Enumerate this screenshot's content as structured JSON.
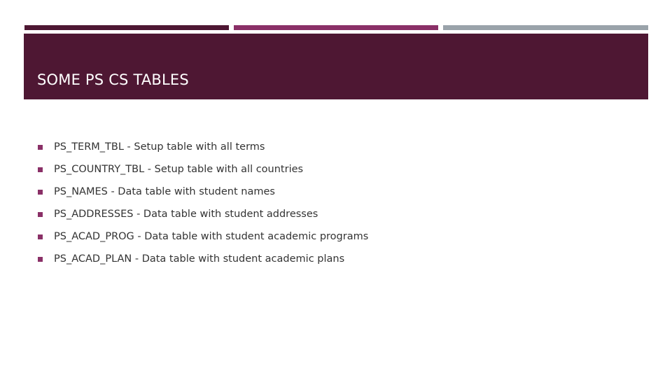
{
  "colors": {
    "bar_1": "#4e1733",
    "bar_2": "#8a3067",
    "bar_3": "#9aa3aa",
    "header_bg": "#4e1733",
    "bullet": "#8a3067"
  },
  "slide": {
    "title": "SOME PS CS TABLES",
    "bullet_icon": "square-bullet-icon",
    "items": [
      {
        "label": "PS_TERM_TBL - Setup table with all terms"
      },
      {
        "label": "PS_COUNTRY_TBL - Setup table with all countries"
      },
      {
        "label": "PS_NAMES - Data table with student names"
      },
      {
        "label": "PS_ADDRESSES - Data table with student addresses"
      },
      {
        "label": "PS_ACAD_PROG - Data table with student academic programs"
      },
      {
        "label": "PS_ACAD_PLAN - Data table with student academic plans"
      }
    ]
  }
}
